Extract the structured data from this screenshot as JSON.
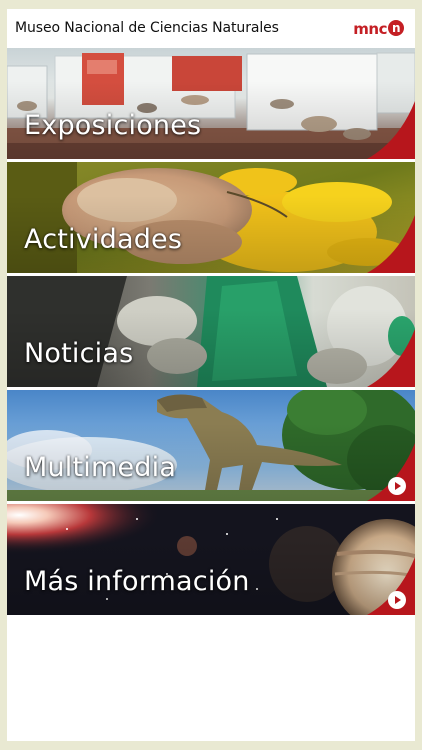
{
  "app": {
    "title": "Museo Nacional de Ciencias Naturales",
    "logo_text": "mnc",
    "logo_badge": "n"
  },
  "menu": {
    "items": [
      {
        "label": "Exposiciones",
        "has_play": false
      },
      {
        "label": "Actividades",
        "has_play": false
      },
      {
        "label": "Noticias",
        "has_play": false
      },
      {
        "label": "Multimedia",
        "has_play": true
      },
      {
        "label": "Más información",
        "has_play": true
      }
    ]
  },
  "colors": {
    "brand_red": "#c41f24",
    "corner_red": "#b7161c",
    "page_background": "#e9e9d2"
  }
}
